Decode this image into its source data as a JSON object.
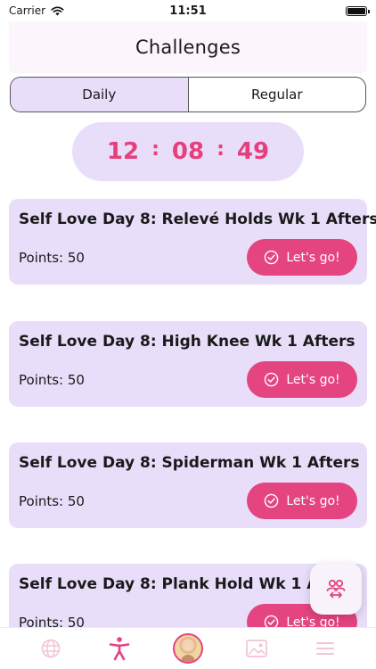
{
  "status_bar": {
    "carrier": "Carrier",
    "time": "11:51"
  },
  "header": {
    "title": "Challenges"
  },
  "tabs": {
    "daily": "Daily",
    "regular": "Regular",
    "active": "daily"
  },
  "timer": {
    "hours": "12",
    "minutes": "08",
    "seconds": "49",
    "separator": ":"
  },
  "challenges": [
    {
      "title": "Self Love Day 8: Relevé Holds Wk 1 Afters",
      "points": "Points: 50",
      "button": "Let's go!"
    },
    {
      "title": "Self Love Day 8: High Knee Wk 1 Afters",
      "points": "Points: 50",
      "button": "Let's go!"
    },
    {
      "title": "Self Love Day 8: Spiderman Wk 1 Afters",
      "points": "Points: 50",
      "button": "Let's go!"
    },
    {
      "title": "Self Love Day 8: Plank Hold Wk 1 Afters",
      "points": "Points: 50",
      "button": "Let's go!"
    }
  ],
  "fab": {
    "icon": "community-icon"
  },
  "bottom_nav": {
    "items": [
      "globe-icon",
      "exercise-icon",
      "avatar",
      "gallery-icon",
      "menu-icon"
    ],
    "active": "exercise-icon"
  },
  "colors": {
    "accent": "#e4447f",
    "card_bg": "#e9defa",
    "timer_text": "#e4407c",
    "header_bg": "#fdf5fc",
    "inactive_icon": "#f0c5d6"
  }
}
